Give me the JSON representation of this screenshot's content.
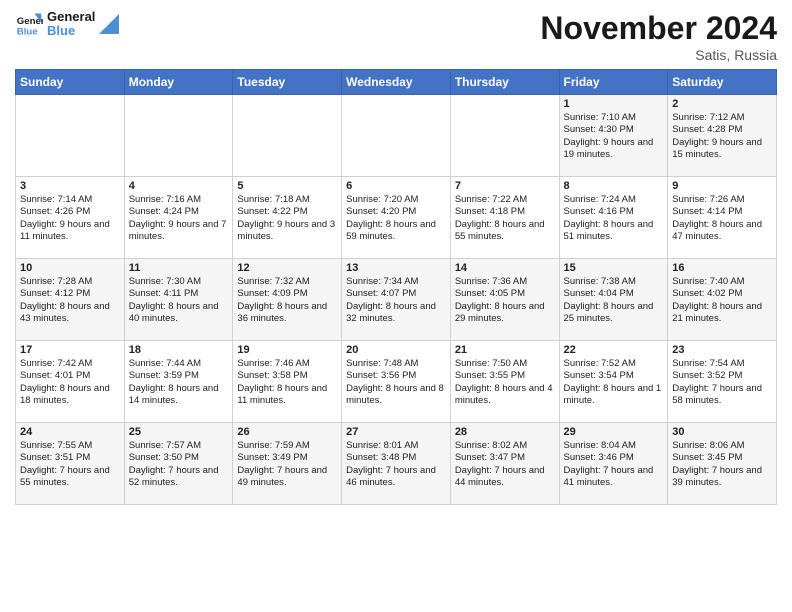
{
  "logo": {
    "line1": "General",
    "line2": "Blue"
  },
  "title": "November 2024",
  "subtitle": "Satis, Russia",
  "days_header": [
    "Sunday",
    "Monday",
    "Tuesday",
    "Wednesday",
    "Thursday",
    "Friday",
    "Saturday"
  ],
  "weeks": [
    [
      {
        "day": "",
        "content": ""
      },
      {
        "day": "",
        "content": ""
      },
      {
        "day": "",
        "content": ""
      },
      {
        "day": "",
        "content": ""
      },
      {
        "day": "",
        "content": ""
      },
      {
        "day": "1",
        "content": "Sunrise: 7:10 AM\nSunset: 4:30 PM\nDaylight: 9 hours and 19 minutes."
      },
      {
        "day": "2",
        "content": "Sunrise: 7:12 AM\nSunset: 4:28 PM\nDaylight: 9 hours and 15 minutes."
      }
    ],
    [
      {
        "day": "3",
        "content": "Sunrise: 7:14 AM\nSunset: 4:26 PM\nDaylight: 9 hours and 11 minutes."
      },
      {
        "day": "4",
        "content": "Sunrise: 7:16 AM\nSunset: 4:24 PM\nDaylight: 9 hours and 7 minutes."
      },
      {
        "day": "5",
        "content": "Sunrise: 7:18 AM\nSunset: 4:22 PM\nDaylight: 9 hours and 3 minutes."
      },
      {
        "day": "6",
        "content": "Sunrise: 7:20 AM\nSunset: 4:20 PM\nDaylight: 8 hours and 59 minutes."
      },
      {
        "day": "7",
        "content": "Sunrise: 7:22 AM\nSunset: 4:18 PM\nDaylight: 8 hours and 55 minutes."
      },
      {
        "day": "8",
        "content": "Sunrise: 7:24 AM\nSunset: 4:16 PM\nDaylight: 8 hours and 51 minutes."
      },
      {
        "day": "9",
        "content": "Sunrise: 7:26 AM\nSunset: 4:14 PM\nDaylight: 8 hours and 47 minutes."
      }
    ],
    [
      {
        "day": "10",
        "content": "Sunrise: 7:28 AM\nSunset: 4:12 PM\nDaylight: 8 hours and 43 minutes."
      },
      {
        "day": "11",
        "content": "Sunrise: 7:30 AM\nSunset: 4:11 PM\nDaylight: 8 hours and 40 minutes."
      },
      {
        "day": "12",
        "content": "Sunrise: 7:32 AM\nSunset: 4:09 PM\nDaylight: 8 hours and 36 minutes."
      },
      {
        "day": "13",
        "content": "Sunrise: 7:34 AM\nSunset: 4:07 PM\nDaylight: 8 hours and 32 minutes."
      },
      {
        "day": "14",
        "content": "Sunrise: 7:36 AM\nSunset: 4:05 PM\nDaylight: 8 hours and 29 minutes."
      },
      {
        "day": "15",
        "content": "Sunrise: 7:38 AM\nSunset: 4:04 PM\nDaylight: 8 hours and 25 minutes."
      },
      {
        "day": "16",
        "content": "Sunrise: 7:40 AM\nSunset: 4:02 PM\nDaylight: 8 hours and 21 minutes."
      }
    ],
    [
      {
        "day": "17",
        "content": "Sunrise: 7:42 AM\nSunset: 4:01 PM\nDaylight: 8 hours and 18 minutes."
      },
      {
        "day": "18",
        "content": "Sunrise: 7:44 AM\nSunset: 3:59 PM\nDaylight: 8 hours and 14 minutes."
      },
      {
        "day": "19",
        "content": "Sunrise: 7:46 AM\nSunset: 3:58 PM\nDaylight: 8 hours and 11 minutes."
      },
      {
        "day": "20",
        "content": "Sunrise: 7:48 AM\nSunset: 3:56 PM\nDaylight: 8 hours and 8 minutes."
      },
      {
        "day": "21",
        "content": "Sunrise: 7:50 AM\nSunset: 3:55 PM\nDaylight: 8 hours and 4 minutes."
      },
      {
        "day": "22",
        "content": "Sunrise: 7:52 AM\nSunset: 3:54 PM\nDaylight: 8 hours and 1 minute."
      },
      {
        "day": "23",
        "content": "Sunrise: 7:54 AM\nSunset: 3:52 PM\nDaylight: 7 hours and 58 minutes."
      }
    ],
    [
      {
        "day": "24",
        "content": "Sunrise: 7:55 AM\nSunset: 3:51 PM\nDaylight: 7 hours and 55 minutes."
      },
      {
        "day": "25",
        "content": "Sunrise: 7:57 AM\nSunset: 3:50 PM\nDaylight: 7 hours and 52 minutes."
      },
      {
        "day": "26",
        "content": "Sunrise: 7:59 AM\nSunset: 3:49 PM\nDaylight: 7 hours and 49 minutes."
      },
      {
        "day": "27",
        "content": "Sunrise: 8:01 AM\nSunset: 3:48 PM\nDaylight: 7 hours and 46 minutes."
      },
      {
        "day": "28",
        "content": "Sunrise: 8:02 AM\nSunset: 3:47 PM\nDaylight: 7 hours and 44 minutes."
      },
      {
        "day": "29",
        "content": "Sunrise: 8:04 AM\nSunset: 3:46 PM\nDaylight: 7 hours and 41 minutes."
      },
      {
        "day": "30",
        "content": "Sunrise: 8:06 AM\nSunset: 3:45 PM\nDaylight: 7 hours and 39 minutes."
      }
    ]
  ]
}
